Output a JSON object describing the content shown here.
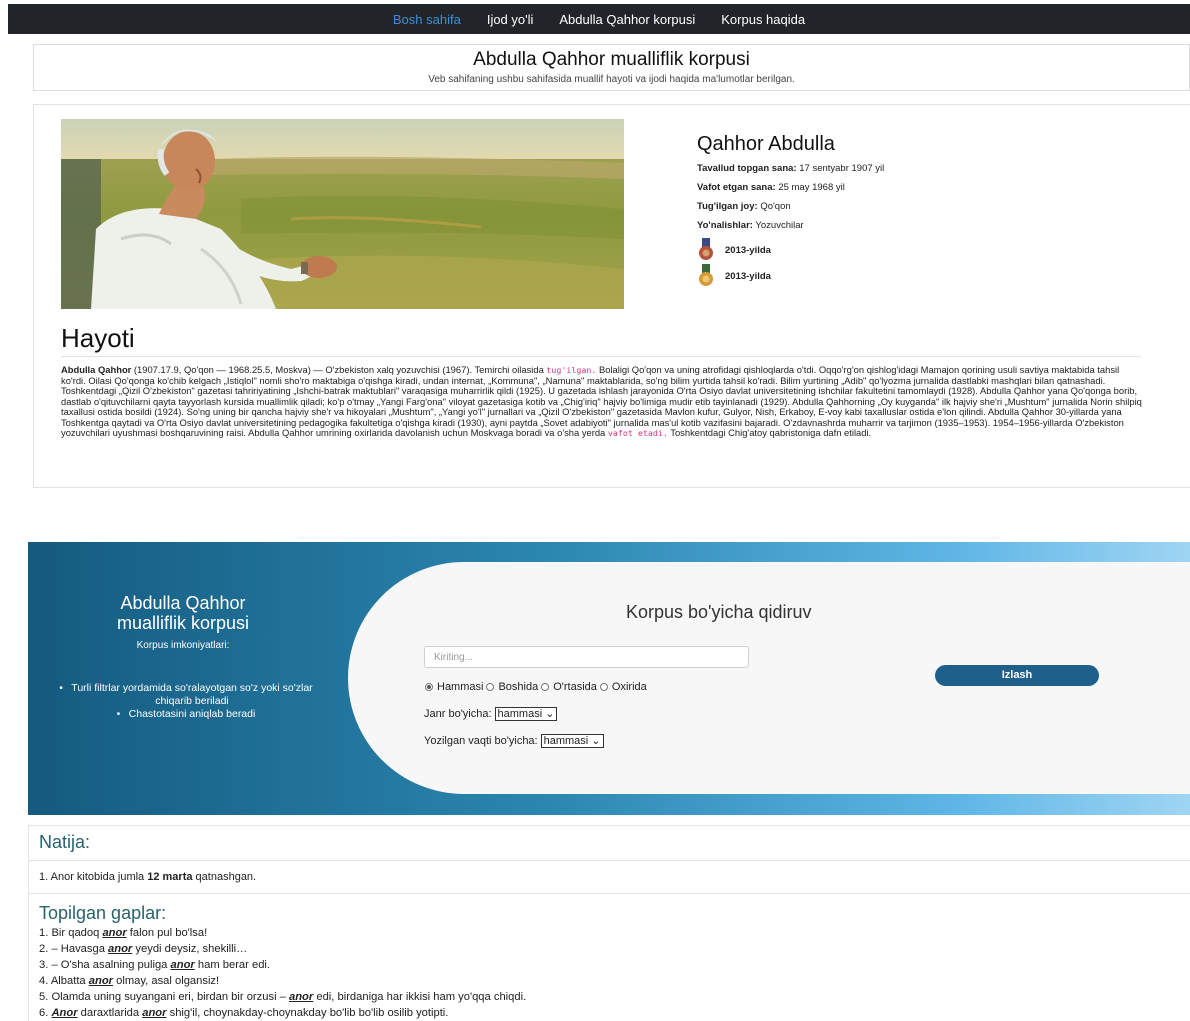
{
  "nav": {
    "items": [
      "Bosh sahifa",
      "Ijod yo'li",
      "Abdulla Qahhor korpusi",
      "Korpus haqida"
    ],
    "active": "Bosh sahifa"
  },
  "header": {
    "title": "Abdulla Qahhor mualliflik korpusi",
    "subtitle": "Veb sahifaning ushbu sahifasida muallif hayoti va ijodi haqida ma'lumotlar berilgan."
  },
  "profile": {
    "name": "Qahhor Abdulla",
    "rows": [
      {
        "label": "Tavallud topgan sana:",
        "value": "17 sentyabr 1907 yil"
      },
      {
        "label": "Vafot etgan sana:",
        "value": "25 may 1968 yil"
      },
      {
        "label": "Tug'ilgan joy:",
        "value": "Qo'qon"
      },
      {
        "label": "Yo'nalishlar:",
        "value": "Yozuvchilar"
      }
    ],
    "awards": [
      "2013-yilda",
      "2013-yilda"
    ]
  },
  "hayoti": {
    "heading": "Hayoti",
    "name_bold": "Abdulla Qahhor",
    "p1": "(1907.17.9, Qo'qon — 1968.25.5, Moskva) — O'zbekiston xalq yozuvchisi (1967). Temirchi oilasida",
    "code1": "tug'ilgan.",
    "p2": "Bolaligi Qo'qon va uning atrofidagi qishloqlarda o'tdi. Oqqo'rg'on qishlog'idagi Mamajon qorining usuli savtiya maktabida tahsil ko'rdi. Oilasi Qo'qonga ko'chib kelgach „Istiqlol\" nomli sho'ro maktabiga o'qishga kiradi, undan internat, „Kommuna\", „Namuna\" maktablarida, so'ng bilim yurtida tahsil ko'radi. Bilim yurtining „Adib\" qo'lyozma jurnalida dastlabki mashqlari bilan qatnashadi. Toshkentdagi „Qizil O'zbekiston\" gazetasi tahririyatining „Ishchi-batrak maktublari\" varaqasiga muharrirlik qildi (1925). U gazetada ishlash jarayonida O'rta Osiyo davlat universitetining ishchilar fakultetini tamomlaydi (1928). Abdulla Qahhor yana Qo'qonga borib, dastlab o'qituvchilarni qayta tayyorlash kursida muallimlik qiladi; ko'p o'tmay „Yangi Farg'ona\" viloyat gazetasiga kotib va „Chig'iriq\" hajviy bo'limiga mudir etib tayinlanadi (1929). Abdulla Qahhorning „Oy kuyganda\" ilk hajviy she'ri „Mushtum\" jurnalida Norin shilpiq taxallusi ostida bosildi (1924). So'ng uning bir qancha hajviy she'r va hikoyalari „Mushtum\", „Yangi yo'l\" jurnallari va „Qizil O'zbekiston\" gazetasida Mavlon kufur, Gulyor, Nish, Erkaboy, E-voy kabi taxalluslar ostida e'lon qilindi. Abdulla Qahhor 30-yillarda yana Toshkentga qaytadi va O'rta Osiyo davlat universitetining pedagogika fakultetiga o'qishga kiradi (1930), ayni paytda „Sovet adabiyoti\" jurnalida mas'ul kotib vazifasini bajaradi. O'zdavnashrda muharrir va tarjimon (1935–1953). 1954–1956-yillarda O'zbekiston yozuvchilari uyushmasi boshqaruvining raisi. Abdulla Qahhor umrining oxirlarida davolanish uchun Moskvaga boradi va o'sha yerda",
    "code2": "vafot etadi.",
    "p3": "Toshkentdagi Chig'atoy qabristoniga dafn etiladi."
  },
  "search_banner": {
    "left_title_1": "Abdulla Qahhor",
    "left_title_2": "mualliflik korpusi",
    "left_subtitle": "Korpus imkoniyatlari:",
    "features": [
      "Turli filtrlar yordamida so'ralayotgan so'z yoki so'zlar chiqarib beriladi",
      "Chastotasini aniqlab beradi"
    ],
    "title": "Korpus bo'yicha qidiruv",
    "input_placeholder": "Kiriting...",
    "button": "Izlash",
    "radios": [
      "Hammasi",
      "Boshida",
      "O'rtasida",
      "Oxirida"
    ],
    "radio_selected": "Hammasi",
    "genre_label": "Janr bo'yicha:",
    "genre_value": "hammasi",
    "time_label": "Yozilgan vaqti bo'yicha:",
    "time_value": "hammasi"
  },
  "results": {
    "heading": "Natija:",
    "count_prefix": "1. Anor kitobida jumla ",
    "count_bold": "12 marta",
    "count_suffix": " qatnashgan.",
    "found_heading": "Topilgan gaplar:",
    "sentences": [
      [
        "1. Bir qadoq ",
        "anor",
        " falon pul bo'lsa!"
      ],
      [
        "2. – Havasga ",
        "anor",
        " yeydi deysiz, shekilli…"
      ],
      [
        "3. – O'sha asalning puliga ",
        "anor",
        " ham berar edi."
      ],
      [
        "4. Albatta ",
        "anor",
        " olmay, asal olgansiz!"
      ],
      [
        "5. Olamda uning suyangani eri, birdan bir orzusi – ",
        "anor",
        " edi, birdaniga har ikkisi ham yo'qqa chiqdi."
      ],
      [
        "6. ",
        "Anor",
        " daraxtlarida ",
        "anor",
        " shig'il, choynakday-choynakday bo'lib bo'lib osilib yotipti."
      ]
    ]
  },
  "colors": {
    "navbar_bg": "#212529",
    "nav_active": "#3b8fd9",
    "banner_dark": "#155a7f",
    "banner_light": "#9fd5f3",
    "button": "#1f5f8b",
    "result_heading": "#27626f",
    "code_text": "#d63384"
  }
}
